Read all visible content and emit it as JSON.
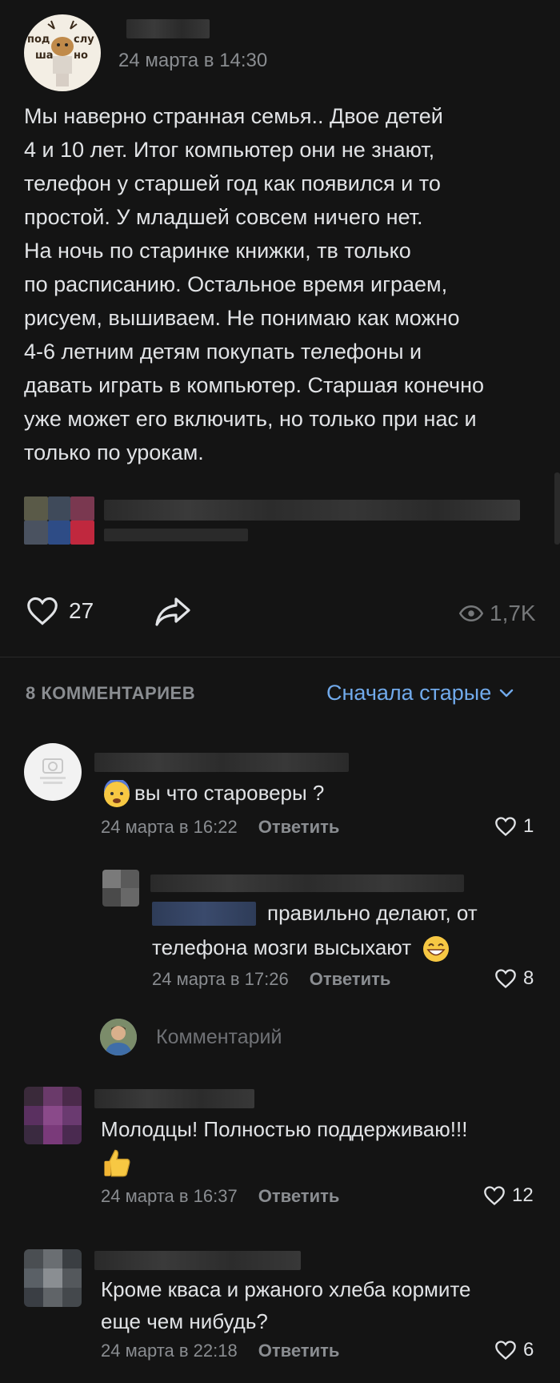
{
  "post": {
    "group_logo_text_1": "под",
    "group_logo_text_2": "слу",
    "group_logo_text_3": "ша",
    "group_logo_text_4": "но",
    "date": "24 марта в 14:30",
    "text": "Мы наверно странная семья.. Двое детей\n4 и 10 лет. Итог компьютер они не знают,\nтелефон у старшей год как появился и то\nпростой. У младшей совсем ничего нет.\nНа ночь по старинке книжки, тв только\nпо расписанию. Остальное время играем,\nрисуем, вышиваем. Не понимаю как можно\n4-6 летним детям покупать телефоны и\nдавать играть в компьютер. Старшая конечно\nуже может его включить, но только при нас и\nтолько по урокам.",
    "likes": "27",
    "views": "1,7K"
  },
  "comments_header": {
    "count_label": "8 КОММЕНТАРИЕВ",
    "sort_label": "Сначала старые"
  },
  "comments": [
    {
      "text": "вы что староверы ?",
      "date": "24 марта в 16:22",
      "reply": "Ответить",
      "likes": "1"
    },
    {
      "text_line1": "правильно делают, от",
      "text_line2": "телефона мозги высыхают",
      "date": "24 марта в 17:26",
      "reply": "Ответить",
      "likes": "8"
    },
    {
      "text": "Молодцы! Полностью поддерживаю!!!",
      "date": "24 марта в 16:37",
      "reply": "Ответить",
      "likes": "12"
    },
    {
      "text_line1": "Кроме кваса и ржаного хлеба кормите",
      "text_line2": "еще чем нибудь?",
      "date": "24 марта в 22:18",
      "reply": "Ответить",
      "likes": "6"
    }
  ],
  "compose": {
    "placeholder": "Комментарий"
  },
  "colors": {
    "background": "#141414",
    "accent": "#71aaeb",
    "secondary_text": "#8a8d91"
  }
}
